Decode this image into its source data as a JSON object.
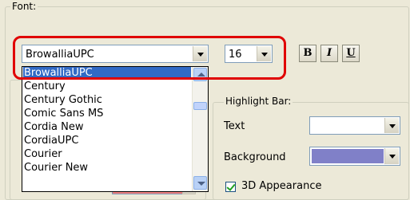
{
  "font_group": {
    "legend": "Font:",
    "font_combo": {
      "value": "BrowalliaUPC"
    },
    "size_combo": {
      "value": "16"
    },
    "bold_label": "B",
    "italic_label": "I",
    "underline_label": "U"
  },
  "font_list": {
    "selected": "BrowalliaUPC",
    "items": [
      "Century",
      "Century Gothic",
      "Comic Sans MS",
      "Cordia New",
      "CordiaUPC",
      "Courier",
      "Courier New"
    ]
  },
  "highlight_group": {
    "legend": "Highlight Bar:",
    "text_label": "Text",
    "text_color": "#ffffff",
    "background_label": "Background",
    "background_color": "#8080c8",
    "appearance_label": "3D Appearance",
    "appearance_checked": true
  },
  "colors": {
    "annotation_ring": "#e00000",
    "selection": "#316ac5",
    "partial_swatch": "#f08080"
  }
}
